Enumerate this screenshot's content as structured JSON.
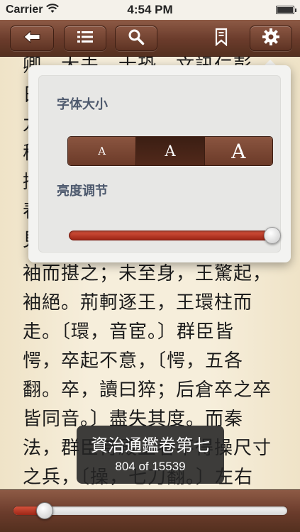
{
  "status_bar": {
    "carrier": "Carrier",
    "time": "4:54 PM",
    "icons": [
      "wifi-icon",
      "battery-icon"
    ]
  },
  "toolbar": {
    "buttons": [
      {
        "name": "back-button",
        "icon": "arrow-left-icon"
      },
      {
        "name": "table-of-contents-button",
        "icon": "list-icon"
      },
      {
        "name": "search-button",
        "icon": "search-icon"
      },
      {
        "name": "bookmark-button",
        "icon": "bookmark-icon"
      },
      {
        "name": "settings-button",
        "icon": "gear-icon"
      }
    ]
  },
  "page_text": {
    "lines": [
      "卿、大夫、士恐。文訊仁彭",
      "日",
      "九",
      "穆",
      "擯",
      "春",
      "見",
      "袖而揕之；未至身，王驚起，",
      "袖絕。荊軻逐王，王環柱而",
      "走。〔環，音宦。〕群臣皆",
      "愕，卒起不意，〔愕，五各",
      "翻。卒，讀曰猝；后倉卒之卒",
      "皆同音。〕盡失其度。而秦",
      "法，群臣侍殿上者不得操尺寸",
      "之兵，〔操，七刀翻。〕左右"
    ]
  },
  "settings_popover": {
    "font_size_label": "字体大小",
    "font_size_options": [
      "A",
      "A",
      "A"
    ],
    "font_size_selected_index": 1,
    "brightness_label": "亮度调节",
    "brightness_level": 0.98
  },
  "chapter_tooltip": {
    "title": "資治通鑑卷第七",
    "page_indicator": "804 of 15539"
  },
  "reading_progress": {
    "current_page": 804,
    "total_pages": 15539
  },
  "colors": {
    "toolbar_brown": "#6a3b2b",
    "slider_red": "#c23b27",
    "label_slate": "#4e5a6e",
    "page_paper": "#f6eedb"
  }
}
